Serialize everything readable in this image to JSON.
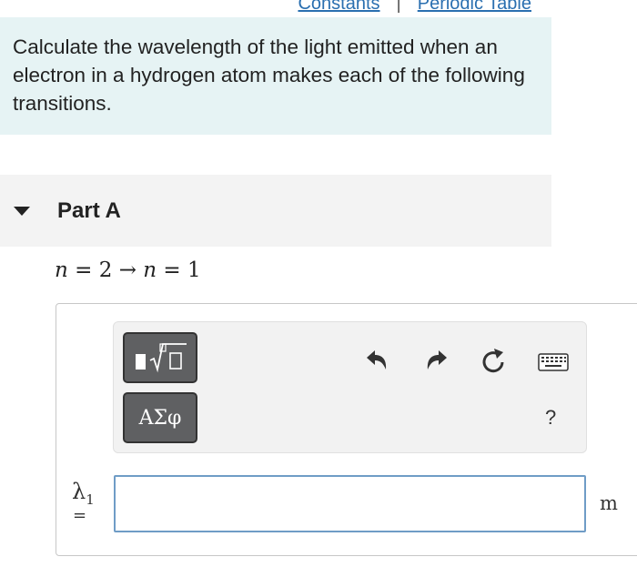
{
  "header": {
    "links": [
      {
        "label": "Constants"
      },
      {
        "label": "Periodic Table"
      }
    ],
    "separator": "|"
  },
  "intro": {
    "text": "Calculate the wavelength of the light emitted when an electron in a hydrogen atom makes each of the following transitions."
  },
  "part": {
    "title": "Part A",
    "transition": {
      "n_initial": "2",
      "n_final": "1",
      "arrow": "→",
      "equals": "=",
      "var": "n"
    }
  },
  "toolbar": {
    "templates_icon": "templates-sqrt-icon",
    "greek_label": "ΑΣφ",
    "undo_icon": "undo-icon",
    "redo_icon": "redo-icon",
    "reset_icon": "reset-icon",
    "keyboard_icon": "keyboard-icon",
    "help_label": "?"
  },
  "answer": {
    "variable": "λ",
    "subscript": "1",
    "equals": "=",
    "value": "",
    "unit": "m"
  },
  "colors": {
    "intro_bg": "#e6f3f4",
    "link": "#2a6fb0",
    "input_border": "#6f9cc6",
    "button_bg": "#5f6062"
  }
}
